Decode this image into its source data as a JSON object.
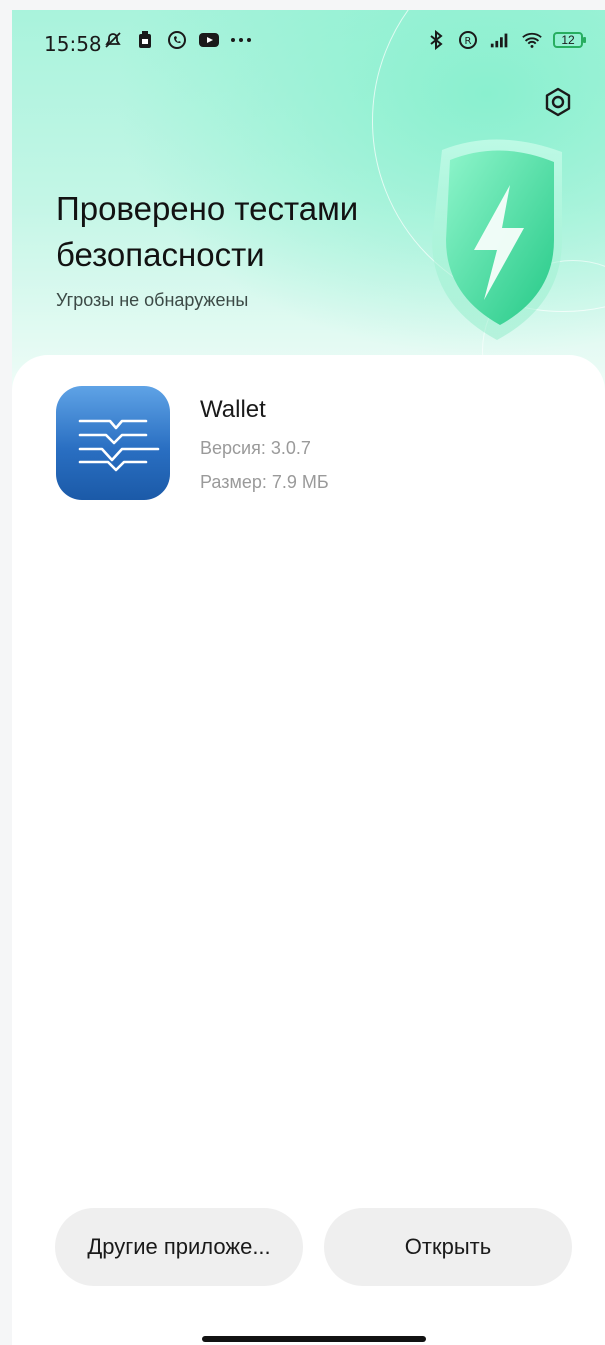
{
  "status_bar": {
    "time": "15:58",
    "battery_level": "12",
    "left_icons": [
      "muted-bell-icon",
      "sim-icon",
      "whatsapp-icon",
      "youtube-icon",
      "more-dots-icon"
    ],
    "right_icons": [
      "bluetooth-icon",
      "roaming-icon",
      "signal-icon",
      "wifi-icon",
      "battery-icon"
    ]
  },
  "header": {
    "title": "Проверено тестами безопасности",
    "subtitle": "Угрозы не обнаружены",
    "settings_icon": "gear-icon"
  },
  "app": {
    "name": "Wallet",
    "version": "Версия: 3.0.7",
    "size": "Размер: 7.9 МБ"
  },
  "actions": {
    "other_apps_label": "Другие приложе...",
    "open_label": "Открыть"
  },
  "colors": {
    "hero_top": "#a9f3dc",
    "shield_green": "#3ddc9a",
    "app_icon_blue": "#2a6fc2",
    "button_bg": "#efefef"
  }
}
